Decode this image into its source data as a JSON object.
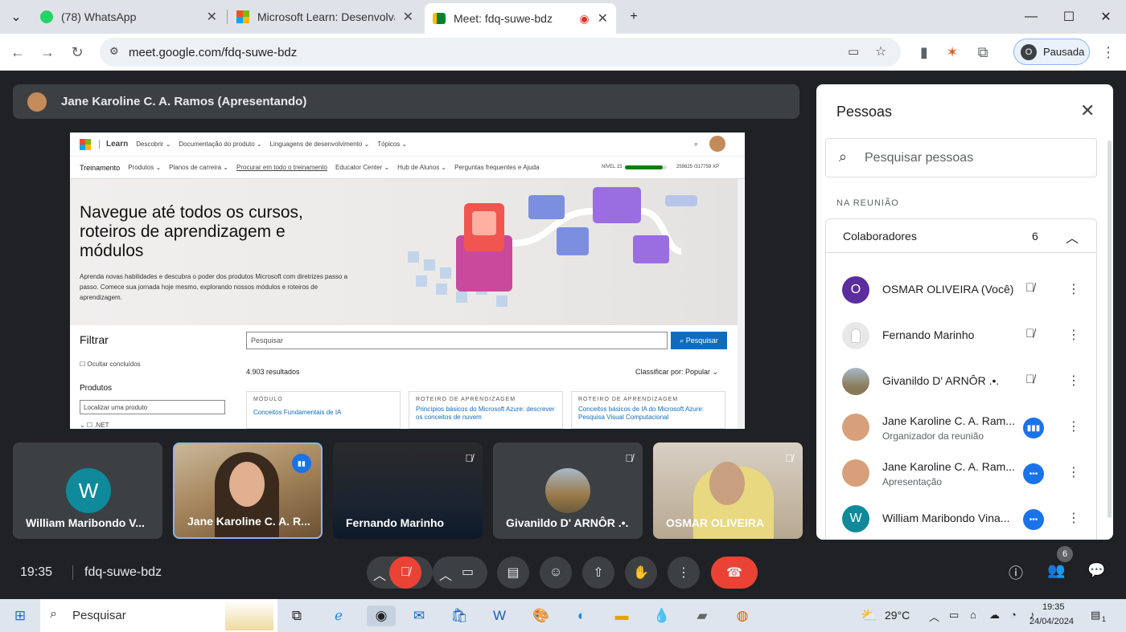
{
  "browser": {
    "tabs": [
      {
        "title": "(78) WhatsApp",
        "icon": "whatsapp-icon"
      },
      {
        "title": "Microsoft Learn: Desenvolva h",
        "icon": "microsoft-icon"
      },
      {
        "title": "Meet: fdq-suwe-bdz",
        "icon": "google-meet-icon",
        "active": true
      }
    ],
    "url": "meet.google.com/fdq-suwe-bdz",
    "profile_initial": "O",
    "profile_label": "Pausada"
  },
  "presentation": {
    "presenter_label": "Jane Karoline C. A. Ramos (Apresentando)",
    "shared": {
      "learn": "Learn",
      "nav1": [
        "Descobrir ⌄",
        "Documentação do produto ⌄",
        "Linguagens de desenvolvimento ⌄",
        "Tópicos ⌄"
      ],
      "nav2": [
        "Treinamento",
        "Produtos ⌄",
        "Planos de carreira ⌄",
        "Procurar em todo o treinamento",
        "Educator Center ⌄",
        "Hub de Alunos ⌄",
        "Perguntas frequentes e Ajuda"
      ],
      "level": "NÍVEL 15",
      "xp": "259825 /317759 XP",
      "hero_title": "Navegue até todos os cursos, roteiros de aprendizagem e módulos",
      "hero_text": "Aprenda novas habilidades e descubra o poder dos produtos Microsoft com diretrizes passo a passo. Comece sua jornada hoje mesmo, explorando nossos módulos e roteiros de aprendizagem.",
      "filter": "Filtrar",
      "hide_completed": "Ocultar concluídos",
      "products": "Produtos",
      "find_product": "Localizar uma produto",
      "net": ".NET",
      "search_placeholder": "Pesquisar",
      "search_button": "Pesquisar",
      "results": "4.903 resultados",
      "sort": "Classificar por: Popular ⌄",
      "cards": [
        {
          "kind": "MÓDULO",
          "title": "Conceitos Fundamentais de IA"
        },
        {
          "kind": "ROTEIRO DE APRENDIZAGEM",
          "title": "Princípios básicos do Microsoft Azure: descrever os conceitos de nuvem"
        },
        {
          "kind": "ROTEIRO DE APRENDIZAGEM",
          "title": "Conceitos básicos de IA do Microsoft Azure: Pesquisa Visual Computacional"
        }
      ]
    }
  },
  "participants_tiles": [
    {
      "name": "William Maribondo V...",
      "initial": "W"
    },
    {
      "name": "Jane Karoline C. A. R..."
    },
    {
      "name": "Fernando Marinho"
    },
    {
      "name": "Givanildo D' ARNÔR .•."
    },
    {
      "name": "OSMAR OLIVEIRA"
    }
  ],
  "people_panel": {
    "title": "Pessoas",
    "search_placeholder": "Pesquisar pessoas",
    "section": "NA REUNIÃO",
    "group": "Colaboradores",
    "count": "6",
    "people": [
      {
        "name": "OSMAR OLIVEIRA (Você)",
        "initial": "O",
        "color": "#5b2d9e"
      },
      {
        "name": "Fernando Marinho",
        "initial": "",
        "color": "#e8e8e8"
      },
      {
        "name": "Givanildo D' ARNÔR .•.",
        "initial": "",
        "color": "#8a7a5a"
      },
      {
        "name": "Jane Karoline C. A. Ram...",
        "sub": "Organizador da reunião",
        "initial": "",
        "color": "#d8a07a"
      },
      {
        "name": "Jane Karoline C. A. Ram...",
        "sub": "Apresentação",
        "initial": "",
        "color": "#d8a07a"
      },
      {
        "name": "William Maribondo Vina...",
        "initial": "W",
        "color": "#0e8a9a"
      }
    ]
  },
  "meeting_bar": {
    "time": "19:35",
    "code": "fdq-suwe-bdz",
    "people_count": "6"
  },
  "taskbar": {
    "search": "Pesquisar",
    "temp": "29°C",
    "time": "19:35",
    "date": "24/04/2024",
    "notif_count": "1"
  }
}
